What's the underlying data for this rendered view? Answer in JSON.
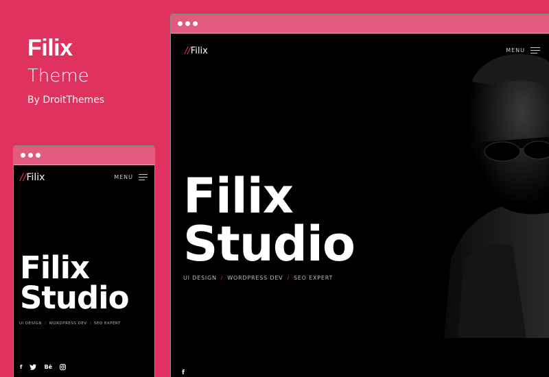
{
  "brand": {
    "title": "Filix",
    "subtitle": "Theme",
    "byline": "By DroitThemes"
  },
  "site": {
    "logo_slash": "//",
    "logo_text": "Filix",
    "menu_label": "MENU",
    "hero_line1": "Filix",
    "hero_line2": "Studio",
    "tags": [
      "UI DESIGN",
      "WORDPRESS DEV",
      "SEO EXPERT"
    ],
    "tag_separator": "/"
  },
  "social": {
    "facebook": "f",
    "twitter": "t",
    "behance": "Bē",
    "instagram": "ig"
  },
  "icons": [
    "facebook-icon",
    "twitter-icon",
    "behance-icon",
    "instagram-icon",
    "hamburger-icon"
  ],
  "colors": {
    "background": "#e0325f",
    "window_bar": "#e35a80",
    "screen": "#000000",
    "accent": "#e0325f",
    "text": "#ffffff"
  }
}
